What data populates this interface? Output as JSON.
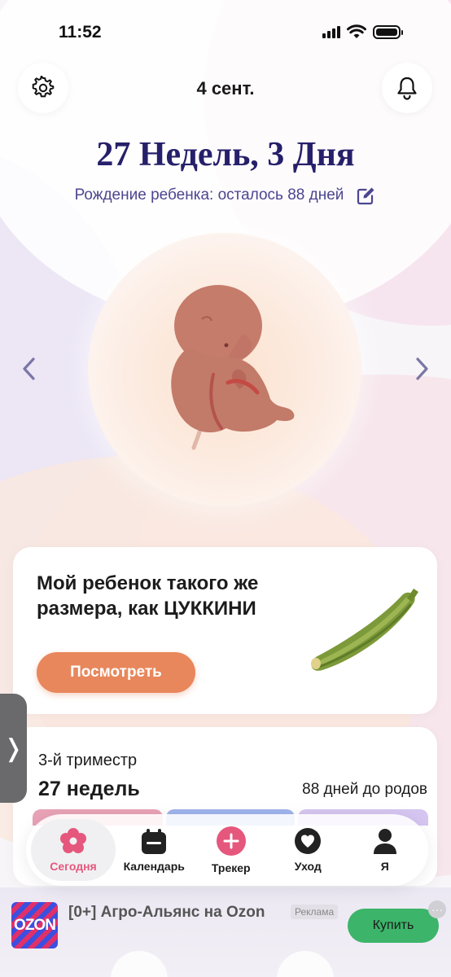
{
  "status_bar": {
    "time": "11:52"
  },
  "header": {
    "date": "4 сент."
  },
  "pregnancy": {
    "weeks_title": "27 Недель, 3 Дня",
    "birth_countdown": "Рождение ребенка: осталось 88 дней"
  },
  "size_card": {
    "text": "Мой ребенок такого же размера, как ЦУККИНИ",
    "button": "Посмотреть"
  },
  "trimester_card": {
    "trimester": "3-й триместр",
    "weeks": "27 недель",
    "days_left": "88 дней до родов"
  },
  "side_tab": {
    "glyph": "❭"
  },
  "tabbar": {
    "items": [
      {
        "label": "Сегодня",
        "icon": "flower-icon",
        "active": true
      },
      {
        "label": "Календарь",
        "icon": "calendar-icon"
      },
      {
        "label": "Трекер",
        "icon": "plus-circle-icon"
      },
      {
        "label": "Уход",
        "icon": "heart-icon"
      },
      {
        "label": "Я",
        "icon": "person-icon"
      }
    ]
  },
  "ad": {
    "logo_text": "OZON",
    "title": "[0+] Агро-Альянс на Ozon",
    "badge": "Реклама",
    "button": "Купить",
    "more": "···"
  },
  "colors": {
    "title": "#26206a",
    "accent_orange": "#e8875c",
    "active_tab": "#e5577d",
    "buy_green": "#3cb46a"
  }
}
